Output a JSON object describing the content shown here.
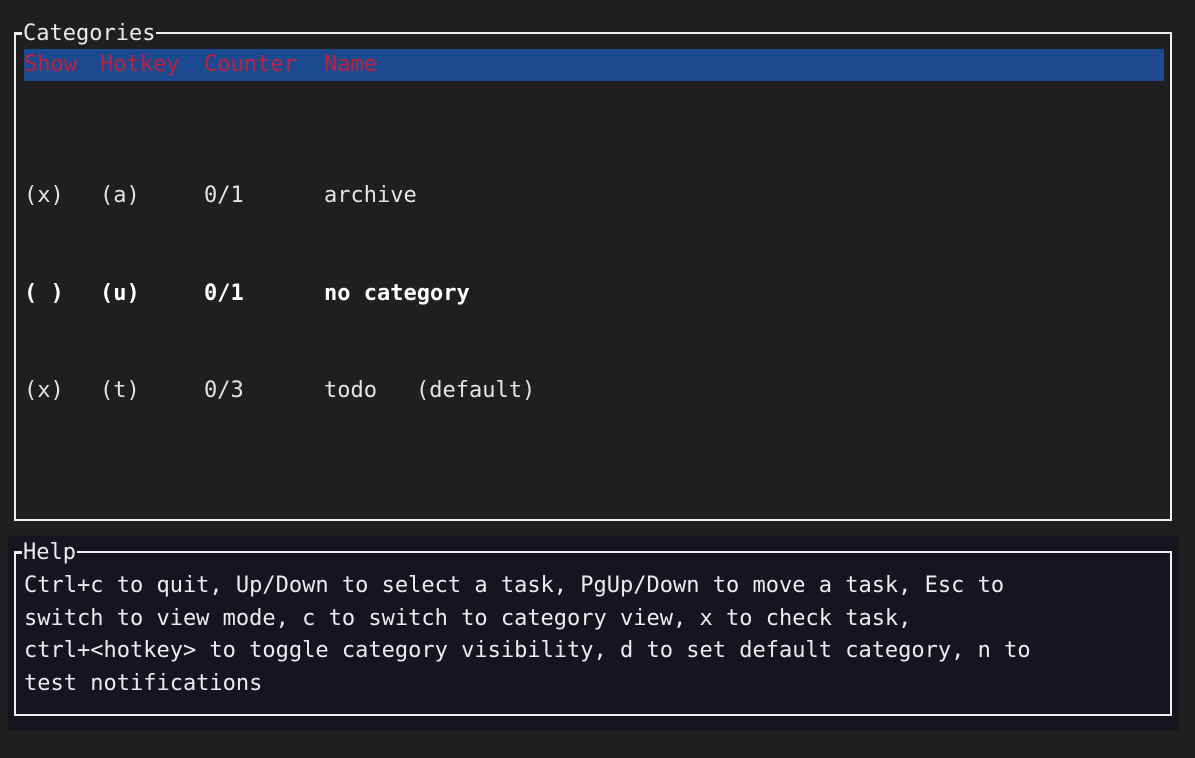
{
  "categories_panel": {
    "title": "Categories",
    "columns": {
      "show": "Show",
      "hotkey": "Hotkey",
      "counter": "Counter",
      "name": "Name"
    },
    "rows": [
      {
        "show": "(x)",
        "hotkey": "(a)",
        "counter": "0/1",
        "name": "archive",
        "suffix": ""
      },
      {
        "show": "( )",
        "hotkey": "(u)",
        "counter": "0/1",
        "name": "no category",
        "suffix": ""
      },
      {
        "show": "(x)",
        "hotkey": "(t)",
        "counter": "0/3",
        "name": "todo",
        "suffix": "(default)"
      }
    ]
  },
  "help_panel": {
    "title": "Help",
    "lines": [
      "Ctrl+c to quit, Up/Down to select a task, PgUp/Down to move a task, Esc to",
      "switch to view mode, c to switch to category view, x to check task,",
      "ctrl+<hotkey> to toggle category visibility, d to set default category, n to",
      "test notifications"
    ]
  },
  "colors": {
    "background": "#1f1f1f",
    "header_bg": "#1b4a91",
    "header_text": "#c2203a",
    "border": "#f0f0f0",
    "help_bg": "#16141f"
  }
}
